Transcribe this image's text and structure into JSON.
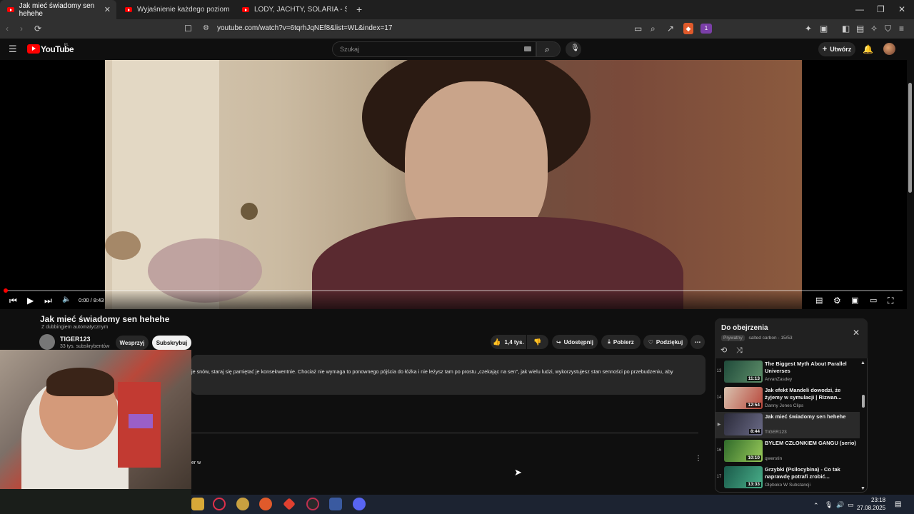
{
  "browser": {
    "tabs": [
      {
        "label": "Jak mieć świadomy sen hehehe",
        "active": true
      },
      {
        "label": "Wyjaśnienie każdego poziomu duch",
        "active": false
      },
      {
        "label": "LODY, JACHTY, SOLARIA - SYMBOLE",
        "active": false
      }
    ],
    "new_tab": "+",
    "url": "youtube.com/watch?v=6tqrhJqNEf8&list=WL&index=17",
    "badge_count": "1"
  },
  "header": {
    "logo": "YouTube",
    "logo_region": "PL",
    "search_placeholder": "Szukaj",
    "create_label": "Utwórz"
  },
  "player": {
    "time": "0:00 / 8:43",
    "progress": 0
  },
  "video": {
    "title": "Jak mieć świadomy sen hehehe",
    "dubbing": "Z dubbingiem automatycznym",
    "channel": "TIGER123",
    "subscribers": "33 tys. subskrybentów",
    "support_label": "Wesprzyj",
    "subscribe_label": "Subskrybuj",
    "likes": "1,4 tys.",
    "share_label": "Udostępnij",
    "download_label": "Pobierz",
    "thanks_label": "Podziękuj",
    "description": "je snów, staraj się pamiętać je konsekwentnie. Chociaż nie wymaga to ponownego pójścia do łóżka i nie leżysz tam po prostu „czekając na sen\", jak wielu ludzi, wykorzystujesz stan senności po przebudzeniu, aby",
    "comment_fragment": "er w"
  },
  "playlist": {
    "title": "Do obejrzenia",
    "privacy": "Prywatny",
    "meta": "salted carbon - 15/53",
    "items": [
      {
        "num": "13",
        "title": "The Biggest Myth About Parallel Universes",
        "channel": "ArvanZasdey",
        "duration": "11:13",
        "current": false
      },
      {
        "num": "14",
        "title": "Jak efekt Mandeli dowodzi, że żyjemy w symulacji | Rizwan...",
        "channel": "Danny Jones Clips",
        "duration": "12:54",
        "current": false
      },
      {
        "num": "▶",
        "title": "Jak mieć świadomy sen hehehe",
        "channel": "TIGER123",
        "duration": "8:44",
        "current": true
      },
      {
        "num": "16",
        "title": "BYŁEM CZŁONKIEM GANGU (serio)",
        "channel": "qwerstin",
        "duration": "10:10",
        "current": false
      },
      {
        "num": "17",
        "title": "Grzybki (Psilocybina) - Co tak naprawdę potrafi zrobić...",
        "channel": "Olęboko W Substancji",
        "duration": "13:33",
        "current": false
      }
    ]
  },
  "taskbar": {
    "time": "23:18",
    "date": "27.08.2025"
  },
  "colors": {
    "accent": "#ff0000",
    "background": "#0f0f0f",
    "surface": "#272727"
  }
}
